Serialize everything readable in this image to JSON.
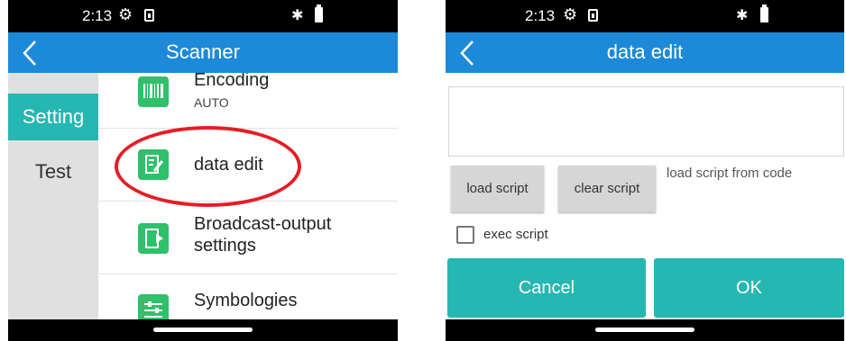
{
  "left": {
    "status": {
      "time": "2:13"
    },
    "app_title": "Scanner",
    "tabs": [
      {
        "label": "Setting"
      },
      {
        "label": "Test"
      }
    ],
    "items": [
      {
        "label": "Encoding",
        "sub": "AUTO",
        "icon": "barcode-icon"
      },
      {
        "label": "data edit",
        "icon": "edit-note-icon"
      },
      {
        "label": "Broadcast-output\nsettings",
        "icon": "exit-door-icon"
      },
      {
        "label": "Symbologies",
        "icon": "sliders-icon"
      }
    ]
  },
  "right": {
    "status": {
      "time": "2:13"
    },
    "app_title": "data edit",
    "script_value": "",
    "load_script": "load script",
    "clear_script": "clear script",
    "hint": "load script from code",
    "exec_script": "exec script",
    "cancel": "Cancel",
    "ok": "OK"
  },
  "colors": {
    "appbar": "#1c8ad8",
    "accent": "#25b7b1",
    "icon_green": "#2fc06b",
    "highlight": "#e41e26"
  }
}
